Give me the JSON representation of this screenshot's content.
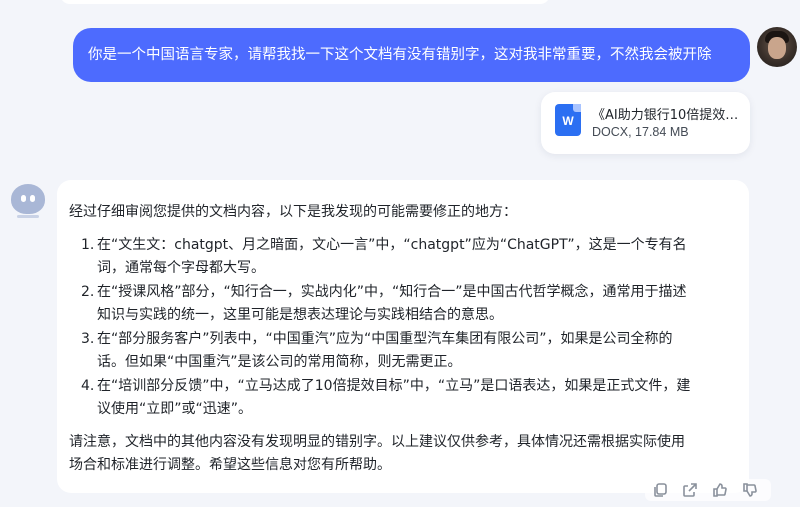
{
  "conversation": {
    "user_message": "你是一个中国语言专家，请帮我找一下这个文档有没有错别字，这对我非常重要，不然我会被开除",
    "attachment": {
      "icon": "word-doc-icon",
      "icon_letter": "W",
      "name": "《AI助力银行10倍提效…",
      "meta": "DOCX, 17.84 MB"
    },
    "assistant": {
      "intro": "经过仔细审阅您提供的文档内容，以下是我发现的可能需要修正的地方：",
      "items": [
        {
          "num": "1.",
          "line1": "在“文生文：chatgpt、月之暗面，文心一言”中，“chatgpt”应为“ChatGPT”，这是一个专有名",
          "line2": "词，通常每个字母都大写。"
        },
        {
          "num": "2.",
          "line1": "在“授课风格”部分，“知行合一，实战内化”中，“知行合一”是中国古代哲学概念，通常用于描述",
          "line2": "知识与实践的统一，这里可能是想表达理论与实践相结合的意思。"
        },
        {
          "num": "3.",
          "line1": "在“部分服务客户”列表中，“中国重汽”应为“中国重型汽车集团有限公司”，如果是公司全称的",
          "line2": "话。但如果“中国重汽”是该公司的常用简称，则无需更正。"
        },
        {
          "num": "4.",
          "line1": "在“培训部分反馈”中，“立马达成了10倍提效目标”中，“立马”是口语表达，如果是正式文件，建",
          "line2": "议使用“立即”或“迅速”。"
        }
      ],
      "closing_line1": "请注意，文档中的其他内容没有发现明显的错别字。以上建议仅供参考，具体情况还需根据实际使用",
      "closing_line2": "场合和标准进行调整。希望这些信息对您有所帮助。"
    }
  },
  "toolbar": {
    "icons": [
      "copy-icon",
      "share-icon",
      "thumbs-up-icon",
      "thumbs-down-icon"
    ]
  },
  "colors": {
    "accent": "#4d6bfe",
    "background": "#f3f5fa",
    "card": "#ffffff",
    "file_icon": "#2b6ff2"
  }
}
